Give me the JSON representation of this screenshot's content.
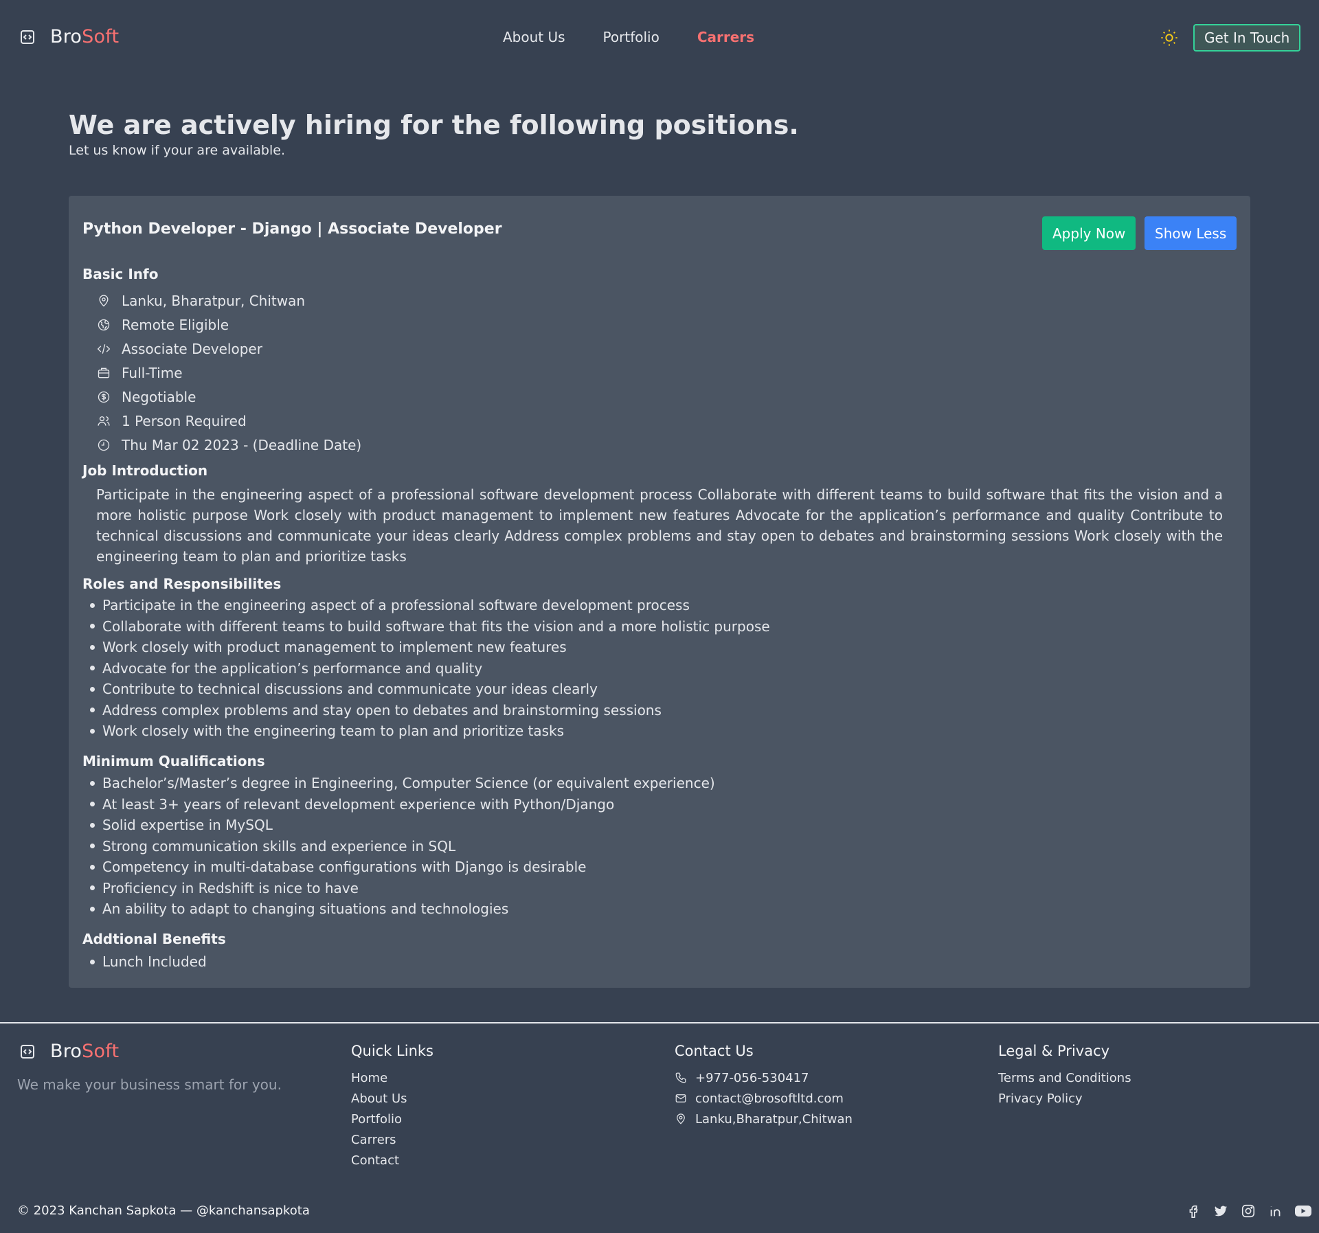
{
  "header": {
    "brand_bro": "Bro",
    "brand_soft": "Soft",
    "nav": [
      "About Us",
      "Portfolio",
      "Carrers"
    ],
    "cta": "Get In Touch"
  },
  "hero": {
    "title": "We are actively hiring for the following positions.",
    "subtitle": "Let us know if your are available."
  },
  "job": {
    "title": "Python Developer - Django  |  Associate Developer",
    "apply_label": "Apply Now",
    "less_label": "Show Less",
    "basic_info_title": "Basic Info",
    "basic_info": [
      {
        "icon": "location-pin-icon",
        "text": "Lanku, Bharatpur, Chitwan"
      },
      {
        "icon": "globe-icon",
        "text": "Remote Eligible"
      },
      {
        "icon": "code-icon",
        "text": "Associate Developer"
      },
      {
        "icon": "briefcase-icon",
        "text": "Full-Time"
      },
      {
        "icon": "dollar-icon",
        "text": "Negotiable"
      },
      {
        "icon": "users-icon",
        "text": "1 Person Required"
      },
      {
        "icon": "clock-icon",
        "text": "Thu Mar 02 2023 - (Deadline Date)"
      }
    ],
    "intro_title": "Job Introduction",
    "intro": "Participate in the engineering aspect of a professional software development process Collaborate with different teams to build software that fits the vision and a more holistic purpose Work closely with product management to implement new features Advocate for the application’s performance and quality Contribute to technical discussions and communicate your ideas clearly Address complex problems and stay open to debates and brainstorming sessions Work closely with the engineering team to plan and prioritize tasks",
    "roles_title": "Roles and Responsibilites",
    "roles": [
      "Participate in the engineering aspect of a professional software development process",
      "Collaborate with different teams to build software that fits the vision and a more holistic purpose",
      "Work closely with product management to implement new features",
      "Advocate for the application’s performance and quality",
      "Contribute to technical discussions and communicate your ideas clearly",
      "Address complex problems and stay open to debates and brainstorming sessions",
      "Work closely with the engineering team to plan and prioritize tasks"
    ],
    "quals_title": "Minimum Qualifications",
    "quals": [
      "Bachelor’s/Master’s degree in Engineering, Computer Science (or equivalent experience)",
      "At least 3+ years of relevant development experience with Python/Django",
      "Solid expertise in MySQL",
      "Strong communication skills and experience in SQL",
      "Competency in multi-database configurations with Django is desirable",
      "Proficiency in Redshift is nice to have",
      "An ability to adapt to changing situations and technologies"
    ],
    "benefits_title": "Addtional Benefits",
    "benefits": [
      "Lunch Included"
    ]
  },
  "footer": {
    "tagline": "We make your business smart for you.",
    "quick_title": "Quick Links",
    "quick": [
      "Home",
      "About Us",
      "Portfolio",
      "Carrers",
      "Contact"
    ],
    "contact_title": "Contact Us",
    "contact": [
      {
        "icon": "phone-icon",
        "text": "+977-056-530417"
      },
      {
        "icon": "mail-icon",
        "text": "contact@brosoftltd.com"
      },
      {
        "icon": "location-pin-icon",
        "text": "Lanku,Bharatpur,Chitwan"
      }
    ],
    "legal_title": "Legal & Privacy",
    "legal": [
      "Terms and Conditions",
      "Privacy Policy"
    ],
    "copyright": "© 2023 Kanchan Sapkota — @kanchansapkota",
    "socials": [
      "facebook-icon",
      "twitter-icon",
      "instagram-icon",
      "linkedin-icon",
      "youtube-icon"
    ]
  },
  "colors": {
    "background": "#374151",
    "card": "#4b5563",
    "accent_red": "#f87171",
    "apply_green": "#10b981",
    "show_less_blue": "#3b82f6",
    "cta_border": "#34d399",
    "sun_yellow": "#facc15"
  }
}
